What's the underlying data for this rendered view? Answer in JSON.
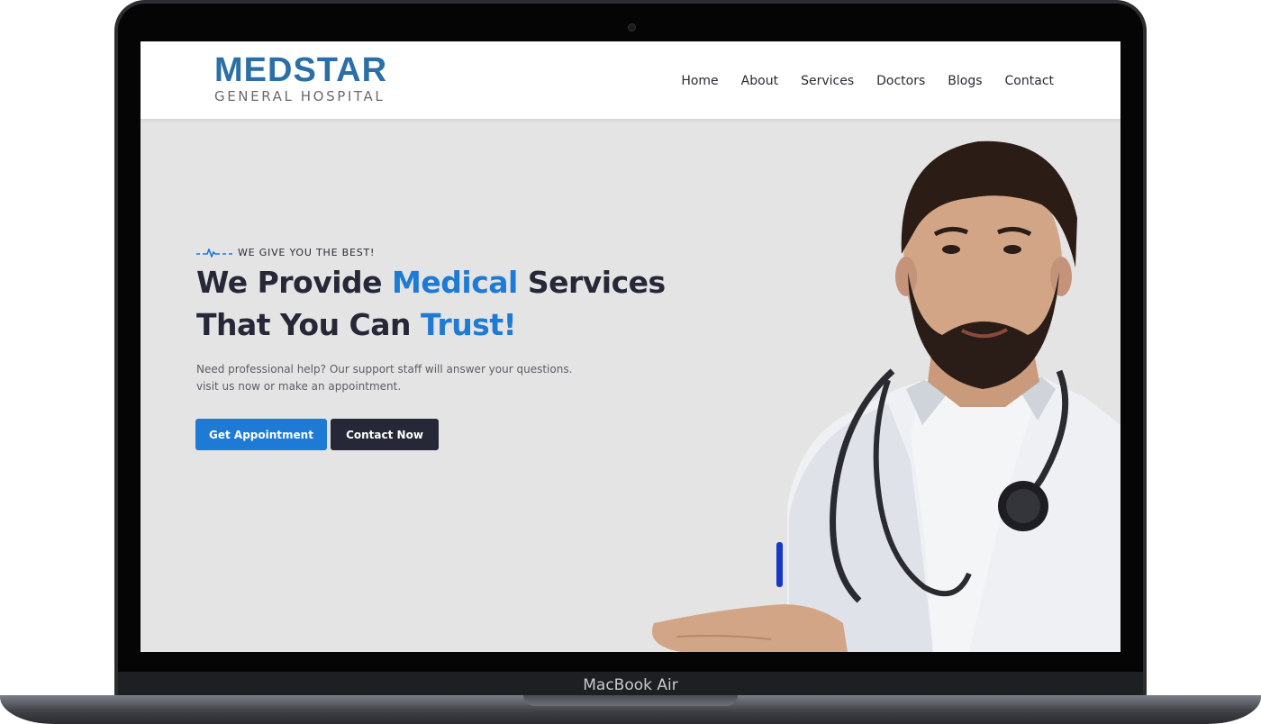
{
  "device": {
    "label": "MacBook Air"
  },
  "header": {
    "logo_title": "MEDSTAR",
    "logo_subtitle": "GENERAL HOSPITAL",
    "nav": [
      {
        "label": "Home"
      },
      {
        "label": "About"
      },
      {
        "label": "Services"
      },
      {
        "label": "Doctors"
      },
      {
        "label": "Blogs"
      },
      {
        "label": "Contact"
      }
    ]
  },
  "hero": {
    "tagline": "WE GIVE YOU THE BEST!",
    "title_line1_part1": "We Provide ",
    "title_line1_accent": "Medical",
    "title_line1_part2": " Services",
    "title_line2_part1": "That You Can ",
    "title_line2_accent": "Trust!",
    "description_line1": "Need professional help? Our support staff will answer your questions.",
    "description_line2": "visit us now or make an appointment.",
    "primary_button": "Get Appointment",
    "secondary_button": "Contact Now"
  },
  "colors": {
    "brand": "#2a6fa6",
    "accent": "#1d7bd6",
    "dark": "#262837",
    "hero_bg": "#e4e4e4"
  },
  "icons": {
    "tagline_icon": "heartbeat-line-icon"
  }
}
